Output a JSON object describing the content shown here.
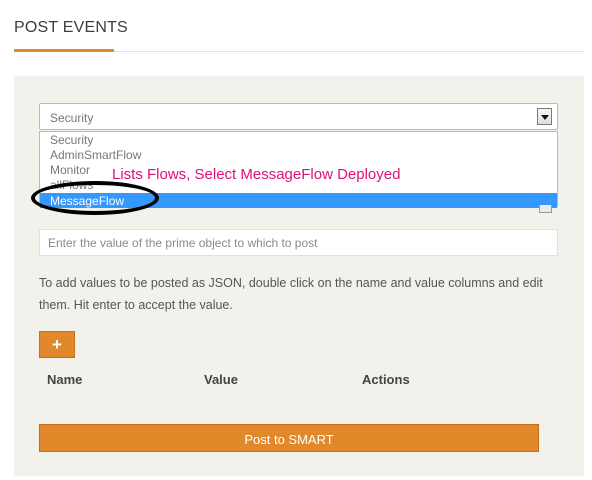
{
  "header": {
    "title": "POST EVENTS"
  },
  "flow_select": {
    "value": "Security",
    "options": [
      "Security",
      "AdminSmartFlow",
      "Monitor",
      "allFlows",
      "MessageFlow"
    ],
    "highlighted": "MessageFlow"
  },
  "annotation": {
    "text": "Lists Flows, Select MessageFlow Deployed",
    "color": "#e0107a"
  },
  "prime_input": {
    "placeholder": "Enter the value of the prime object to which to post",
    "value": ""
  },
  "help_text": "To add values to be posted as JSON, double click on the name and value columns and edit them. Hit enter to accept the value.",
  "add_button": {
    "label": "+"
  },
  "table": {
    "columns": [
      "Name",
      "Value",
      "Actions"
    ]
  },
  "post_button": {
    "label": "Post to SMART"
  },
  "colors": {
    "accent": "#e0882a",
    "highlight": "#3399ff",
    "panel": "#f3f1ec"
  }
}
